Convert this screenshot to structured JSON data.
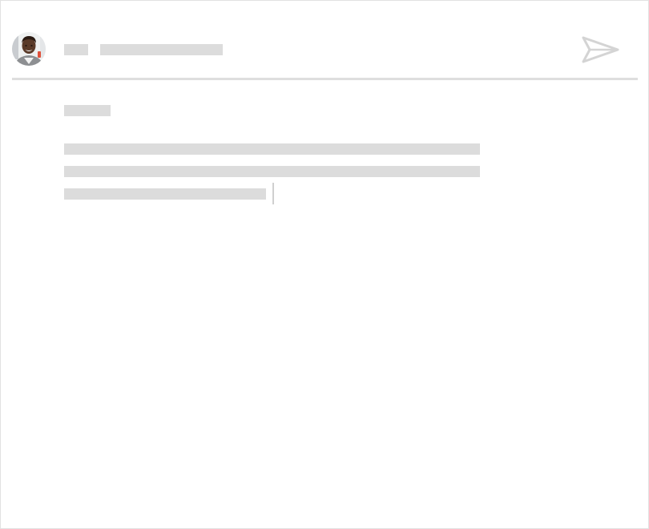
{
  "composer": {
    "sender_avatar": "person-photo",
    "header": {
      "name_placeholder": "",
      "recipient_placeholder": ""
    },
    "body": {
      "greeting_placeholder": "",
      "lines": [
        "",
        "",
        ""
      ]
    },
    "send_icon": "paper-plane-icon"
  },
  "colors": {
    "placeholder": "#dcdcdc",
    "divider": "#dedede",
    "icon_stroke": "#d4d4d4",
    "border": "#e2e2e2"
  }
}
